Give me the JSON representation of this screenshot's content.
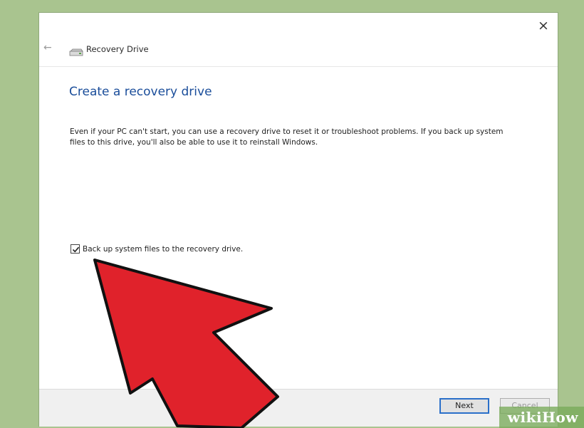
{
  "window": {
    "title": "Recovery Drive",
    "close_symbol": "×",
    "back_symbol": "←",
    "drive_icon": "drive-icon"
  },
  "main": {
    "heading": "Create a recovery drive",
    "description": "Even if your PC can't start, you can use a recovery drive to reset it or troubleshoot problems. If you back up system files to this drive, you'll also be able to use it to reinstall Windows.",
    "checkbox": {
      "label": "Back up system files to the recovery drive.",
      "checked": true
    }
  },
  "footer": {
    "next_label": "Next",
    "cancel_label": "Cancel"
  },
  "watermark": {
    "text": "wikiHow"
  },
  "colors": {
    "heading": "#1a4d9a",
    "arrow": "#e0222b",
    "background": "#a9c48f",
    "primary_button_border": "#2a6fc9"
  }
}
